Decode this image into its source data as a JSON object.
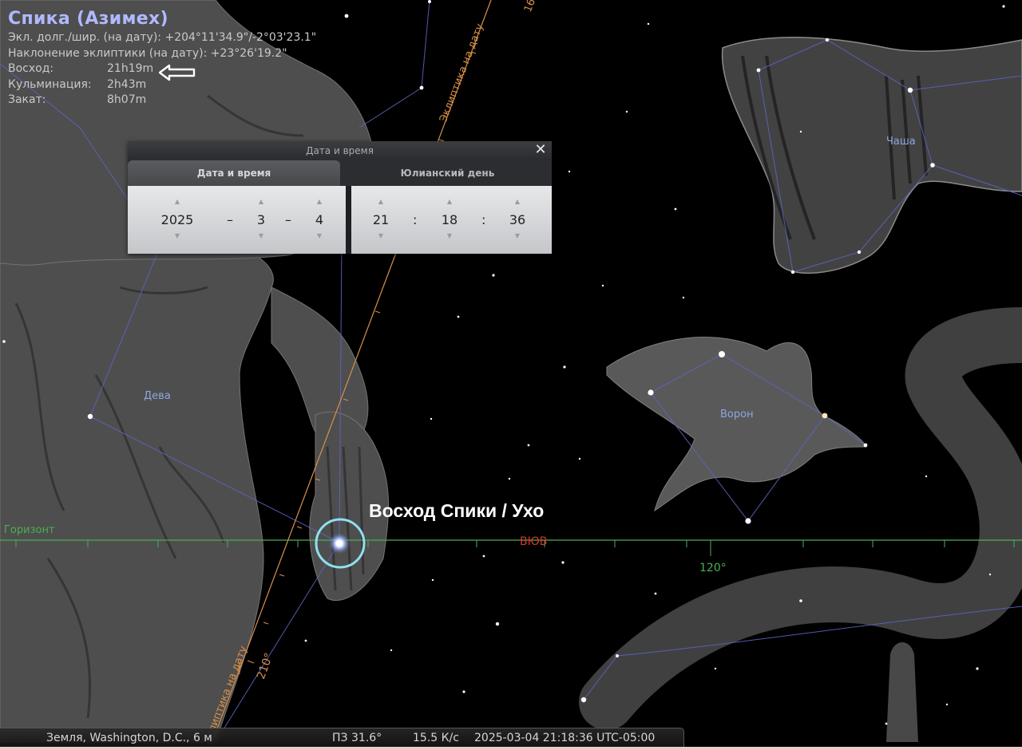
{
  "object_info": {
    "title": "Спика (Азимех)",
    "ecliptic": "Экл. долг./шир. (на дату): +204°11'34.9\"/-2°03'23.1\"",
    "obliquity": "Наклонение эклиптики (на дату): +23°26'19.2\"",
    "rise_label": "Восход:",
    "rise_value": "21h19m",
    "culmination_label": "Кульминация:",
    "culmination_value": "2h43m",
    "set_label": "Закат:",
    "set_value": "8h07m"
  },
  "dialog": {
    "title": "Дата и время",
    "close": "✕",
    "tabs": [
      "Дата и время",
      "Юлианский день"
    ],
    "date": {
      "year": "2025",
      "month": "3",
      "day": "4",
      "sep1": "–",
      "sep2": "–"
    },
    "time": {
      "hour": "21",
      "minute": "18",
      "second": "36",
      "sep1": ":",
      "sep2": ":"
    },
    "arrow_up": "▲",
    "arrow_down": "▼"
  },
  "annotation": "Восход Спики / Ухо",
  "sky_labels": {
    "horizon": "Горизонт",
    "cardinal": "ВЮВ",
    "azimuth_120": "120°",
    "azimuth_210": "210°",
    "ecliptic_top": "Эклиптика на дату",
    "ecliptic_bottom": "Эклиптика на дату",
    "ecliptic_edge": "16",
    "virgo": "Дева",
    "corvus": "Ворон",
    "crater": "Чаша"
  },
  "status": {
    "location": "Земля, Washington, D.C., 6 м",
    "fov": "ПЗ 31.6°",
    "fps": "15.5 К/с",
    "datetime": "2025-03-04 21:18:36 UTC-05:00"
  },
  "colors": {
    "horizon": "#4caf50",
    "ecliptic": "#d9904a",
    "constellation_lines": "#5b64c0",
    "constellation_names": "#8ea6e0",
    "cardinal": "#d23b2a",
    "title": "#b0b9ff",
    "selection": "#8fe0f0"
  }
}
